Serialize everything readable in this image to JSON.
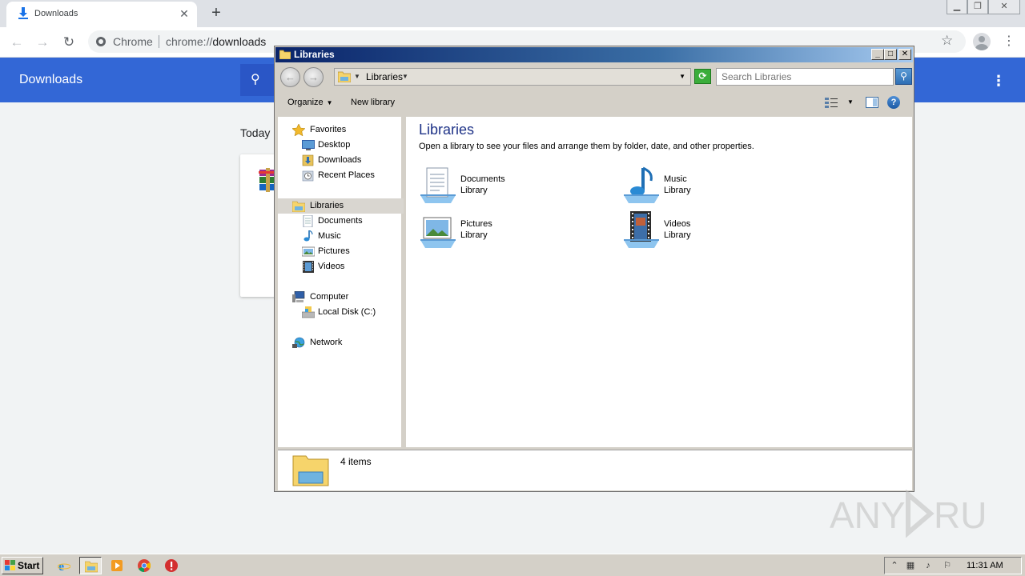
{
  "chrome": {
    "tab_title": "Downloads",
    "new_tab": "+",
    "omnibox_label": "Chrome",
    "url_scheme": "chrome://",
    "url_host": "downloads"
  },
  "downloads_page": {
    "title": "Downloads",
    "section_today": "Today"
  },
  "explorer": {
    "title": "Libraries",
    "address": "Libraries",
    "search_placeholder": "Search Libraries",
    "commands": {
      "organize": "Organize",
      "new_library": "New library"
    },
    "nav": {
      "favorites": "Favorites",
      "desktop": "Desktop",
      "downloads": "Downloads",
      "recent_places": "Recent Places",
      "libraries": "Libraries",
      "documents": "Documents",
      "music": "Music",
      "pictures": "Pictures",
      "videos": "Videos",
      "computer": "Computer",
      "local_disk": "Local Disk (C:)",
      "network": "Network"
    },
    "content": {
      "heading": "Libraries",
      "description": "Open a library to see your files and arrange them by folder, date, and other properties.",
      "items": [
        {
          "name": "Documents",
          "type": "Library",
          "icon": "documents-library-icon"
        },
        {
          "name": "Music",
          "type": "Library",
          "icon": "music-library-icon"
        },
        {
          "name": "Pictures",
          "type": "Library",
          "icon": "pictures-library-icon"
        },
        {
          "name": "Videos",
          "type": "Library",
          "icon": "videos-library-icon"
        }
      ]
    },
    "details": {
      "count": "4 items"
    }
  },
  "taskbar": {
    "start_label": "Start",
    "clock": "11:31 AM"
  },
  "watermark": {
    "text": "ANY RUN"
  },
  "colors": {
    "chrome_header": "#3367d6",
    "titlebar_start": "#0a246a",
    "content_heading": "#1e3287"
  }
}
